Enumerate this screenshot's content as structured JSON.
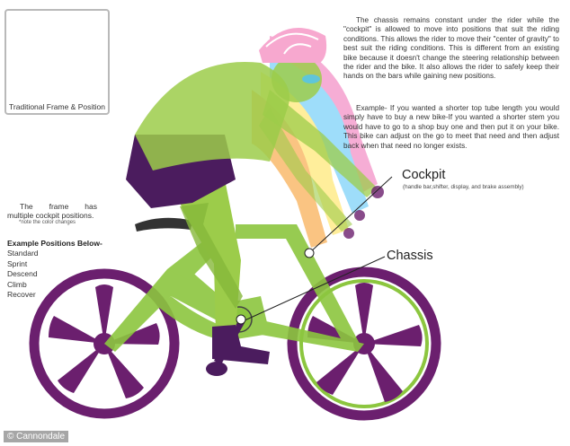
{
  "inset": {
    "caption": "Traditional Frame & Position"
  },
  "description": {
    "paragraph_1": "The chassis remains constant under the rider while the \"cockpit\" is allowed to move into positions that suit the riding conditions. This allows the rider to move their \"center of gravity\" to best suit the riding conditions. This is different from an existing bike because it doesn't change the steering relationship between the rider and the bike. It also allows the rider to safely keep their hands on the bars while gaining new positions.",
    "paragraph_2": "Example- If you wanted a shorter top tube length you would simply have to buy a new bike-If you wanted a shorter stem you would have to go to a shop buy one and then put it on your bike. This bike can adjust on the go to meet that need and then adjust back when that need no longer exists."
  },
  "frame_note": {
    "text": "The frame has multiple cockpit positions.",
    "subnote": "*note the color changes"
  },
  "positions": {
    "heading": "Example Positions Below-",
    "items": [
      "Standard",
      "Sprint",
      "Descend",
      "Climb",
      "Recover"
    ]
  },
  "labels": {
    "cockpit": "Cockpit",
    "cockpit_sub": "(handle bar,shifter, display, and brake assembly)",
    "chassis": "Chassis"
  },
  "credit": "© Cannondale",
  "colors": {
    "frame_green": "#8cc63f",
    "wheel_purple": "#6b1f6e",
    "shorts_purple": "#4b1c5e",
    "rider_green": "#9ccc4a",
    "cockpit_pink": "#f06bb4",
    "cockpit_blue": "#4fc3f7",
    "cockpit_yellow": "#ffe14a",
    "cockpit_orange": "#f7941d",
    "helmet_pink": "#f7a8cf"
  }
}
